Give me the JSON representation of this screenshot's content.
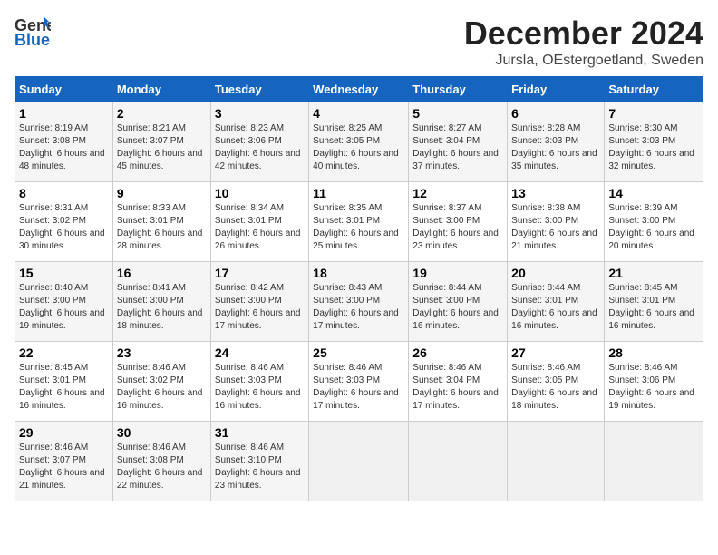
{
  "header": {
    "logo_general": "General",
    "logo_blue": "Blue",
    "month_title": "December 2024",
    "location": "Jursla, OEstergoetland, Sweden"
  },
  "weekdays": [
    "Sunday",
    "Monday",
    "Tuesday",
    "Wednesday",
    "Thursday",
    "Friday",
    "Saturday"
  ],
  "weeks": [
    [
      {
        "day": "1",
        "sunrise": "8:19 AM",
        "sunset": "3:08 PM",
        "daylight": "6 hours and 48 minutes."
      },
      {
        "day": "2",
        "sunrise": "8:21 AM",
        "sunset": "3:07 PM",
        "daylight": "6 hours and 45 minutes."
      },
      {
        "day": "3",
        "sunrise": "8:23 AM",
        "sunset": "3:06 PM",
        "daylight": "6 hours and 42 minutes."
      },
      {
        "day": "4",
        "sunrise": "8:25 AM",
        "sunset": "3:05 PM",
        "daylight": "6 hours and 40 minutes."
      },
      {
        "day": "5",
        "sunrise": "8:27 AM",
        "sunset": "3:04 PM",
        "daylight": "6 hours and 37 minutes."
      },
      {
        "day": "6",
        "sunrise": "8:28 AM",
        "sunset": "3:03 PM",
        "daylight": "6 hours and 35 minutes."
      },
      {
        "day": "7",
        "sunrise": "8:30 AM",
        "sunset": "3:03 PM",
        "daylight": "6 hours and 32 minutes."
      }
    ],
    [
      {
        "day": "8",
        "sunrise": "8:31 AM",
        "sunset": "3:02 PM",
        "daylight": "6 hours and 30 minutes."
      },
      {
        "day": "9",
        "sunrise": "8:33 AM",
        "sunset": "3:01 PM",
        "daylight": "6 hours and 28 minutes."
      },
      {
        "day": "10",
        "sunrise": "8:34 AM",
        "sunset": "3:01 PM",
        "daylight": "6 hours and 26 minutes."
      },
      {
        "day": "11",
        "sunrise": "8:35 AM",
        "sunset": "3:01 PM",
        "daylight": "6 hours and 25 minutes."
      },
      {
        "day": "12",
        "sunrise": "8:37 AM",
        "sunset": "3:00 PM",
        "daylight": "6 hours and 23 minutes."
      },
      {
        "day": "13",
        "sunrise": "8:38 AM",
        "sunset": "3:00 PM",
        "daylight": "6 hours and 21 minutes."
      },
      {
        "day": "14",
        "sunrise": "8:39 AM",
        "sunset": "3:00 PM",
        "daylight": "6 hours and 20 minutes."
      }
    ],
    [
      {
        "day": "15",
        "sunrise": "8:40 AM",
        "sunset": "3:00 PM",
        "daylight": "6 hours and 19 minutes."
      },
      {
        "day": "16",
        "sunrise": "8:41 AM",
        "sunset": "3:00 PM",
        "daylight": "6 hours and 18 minutes."
      },
      {
        "day": "17",
        "sunrise": "8:42 AM",
        "sunset": "3:00 PM",
        "daylight": "6 hours and 17 minutes."
      },
      {
        "day": "18",
        "sunrise": "8:43 AM",
        "sunset": "3:00 PM",
        "daylight": "6 hours and 17 minutes."
      },
      {
        "day": "19",
        "sunrise": "8:44 AM",
        "sunset": "3:00 PM",
        "daylight": "6 hours and 16 minutes."
      },
      {
        "day": "20",
        "sunrise": "8:44 AM",
        "sunset": "3:01 PM",
        "daylight": "6 hours and 16 minutes."
      },
      {
        "day": "21",
        "sunrise": "8:45 AM",
        "sunset": "3:01 PM",
        "daylight": "6 hours and 16 minutes."
      }
    ],
    [
      {
        "day": "22",
        "sunrise": "8:45 AM",
        "sunset": "3:01 PM",
        "daylight": "6 hours and 16 minutes."
      },
      {
        "day": "23",
        "sunrise": "8:46 AM",
        "sunset": "3:02 PM",
        "daylight": "6 hours and 16 minutes."
      },
      {
        "day": "24",
        "sunrise": "8:46 AM",
        "sunset": "3:03 PM",
        "daylight": "6 hours and 16 minutes."
      },
      {
        "day": "25",
        "sunrise": "8:46 AM",
        "sunset": "3:03 PM",
        "daylight": "6 hours and 17 minutes."
      },
      {
        "day": "26",
        "sunrise": "8:46 AM",
        "sunset": "3:04 PM",
        "daylight": "6 hours and 17 minutes."
      },
      {
        "day": "27",
        "sunrise": "8:46 AM",
        "sunset": "3:05 PM",
        "daylight": "6 hours and 18 minutes."
      },
      {
        "day": "28",
        "sunrise": "8:46 AM",
        "sunset": "3:06 PM",
        "daylight": "6 hours and 19 minutes."
      }
    ],
    [
      {
        "day": "29",
        "sunrise": "8:46 AM",
        "sunset": "3:07 PM",
        "daylight": "6 hours and 21 minutes."
      },
      {
        "day": "30",
        "sunrise": "8:46 AM",
        "sunset": "3:08 PM",
        "daylight": "6 hours and 22 minutes."
      },
      {
        "day": "31",
        "sunrise": "8:46 AM",
        "sunset": "3:10 PM",
        "daylight": "6 hours and 23 minutes."
      },
      null,
      null,
      null,
      null
    ]
  ]
}
